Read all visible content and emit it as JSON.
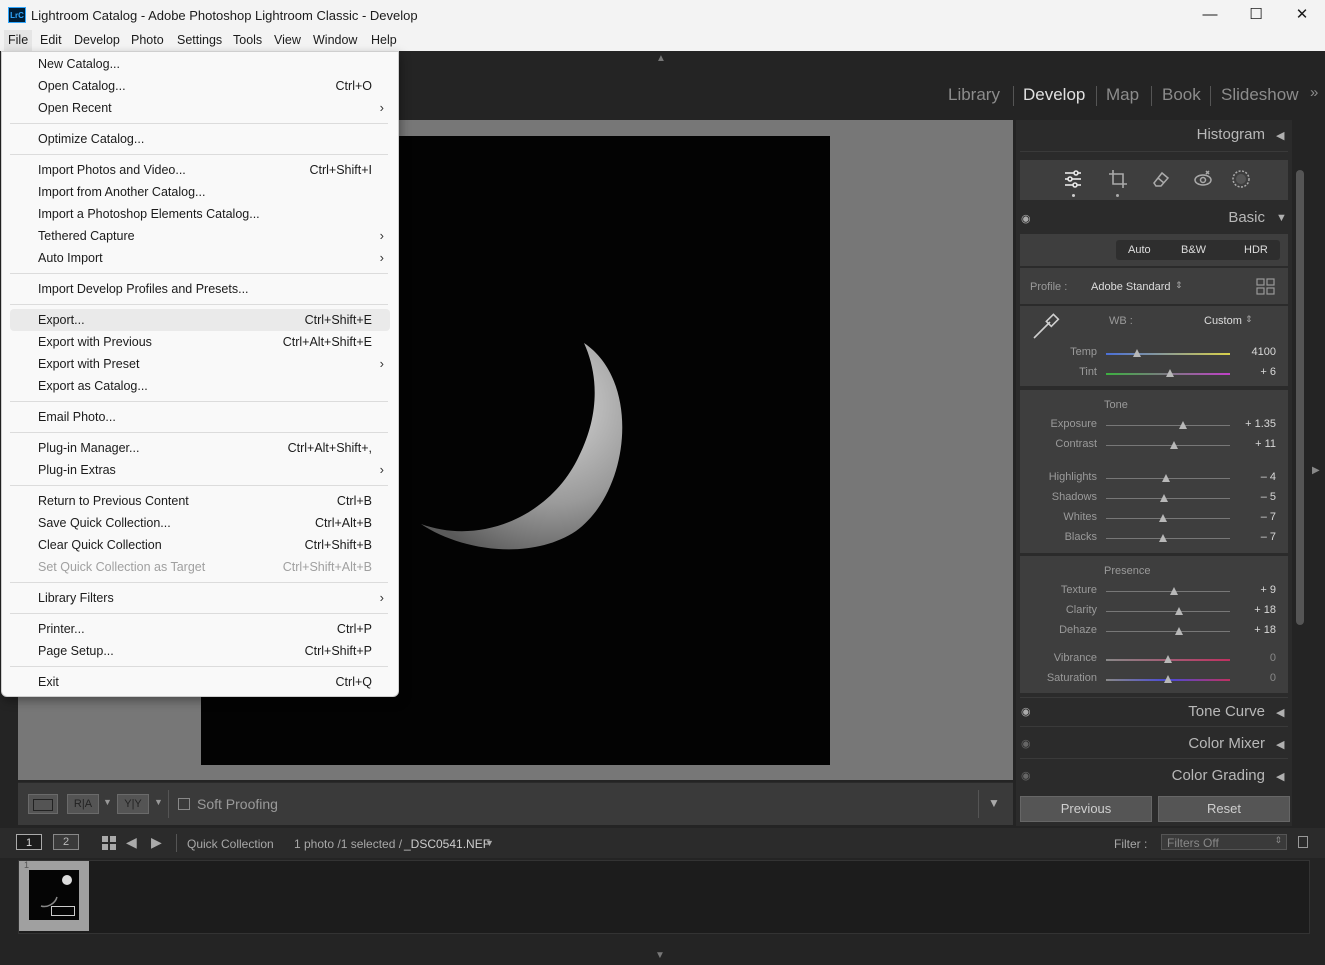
{
  "window": {
    "title": "Lightroom Catalog - Adobe Photoshop Lightroom Classic - Develop",
    "app_icon": "LrC",
    "controls": {
      "minimize": "—",
      "maximize": "☐",
      "close": "✕"
    }
  },
  "menubar": [
    "File",
    "Edit",
    "Develop",
    "Photo",
    "Settings",
    "Tools",
    "View",
    "Window",
    "Help"
  ],
  "modules": [
    "Library",
    "Develop",
    "Map",
    "Book",
    "Slideshow"
  ],
  "active_module": "Develop",
  "file_menu": {
    "items": [
      {
        "label": "New Catalog...",
        "shortcut": ""
      },
      {
        "label": "Open Catalog...",
        "shortcut": "Ctrl+O"
      },
      {
        "label": "Open Recent",
        "shortcut": "",
        "submenu": true
      },
      {
        "sep": true
      },
      {
        "label": "Optimize Catalog...",
        "shortcut": ""
      },
      {
        "sep": true
      },
      {
        "label": "Import Photos and Video...",
        "shortcut": "Ctrl+Shift+I"
      },
      {
        "label": "Import from Another Catalog...",
        "shortcut": ""
      },
      {
        "label": "Import a Photoshop Elements Catalog...",
        "shortcut": ""
      },
      {
        "label": "Tethered Capture",
        "shortcut": "",
        "submenu": true
      },
      {
        "label": "Auto Import",
        "shortcut": "",
        "submenu": true
      },
      {
        "sep": true
      },
      {
        "label": "Import Develop Profiles and Presets...",
        "shortcut": ""
      },
      {
        "sep": true
      },
      {
        "label": "Export...",
        "shortcut": "Ctrl+Shift+E",
        "highlighted": true
      },
      {
        "label": "Export with Previous",
        "shortcut": "Ctrl+Alt+Shift+E"
      },
      {
        "label": "Export with Preset",
        "shortcut": "",
        "submenu": true
      },
      {
        "label": "Export as Catalog...",
        "shortcut": ""
      },
      {
        "sep": true
      },
      {
        "label": "Email Photo...",
        "shortcut": ""
      },
      {
        "sep": true
      },
      {
        "label": "Plug-in Manager...",
        "shortcut": "Ctrl+Alt+Shift+,"
      },
      {
        "label": "Plug-in Extras",
        "shortcut": "",
        "submenu": true
      },
      {
        "sep": true
      },
      {
        "label": "Return to Previous Content",
        "shortcut": "Ctrl+B"
      },
      {
        "label": "Save Quick Collection...",
        "shortcut": "Ctrl+Alt+B"
      },
      {
        "label": "Clear Quick Collection",
        "shortcut": "Ctrl+Shift+B"
      },
      {
        "label": "Set Quick Collection as Target",
        "shortcut": "Ctrl+Shift+Alt+B",
        "disabled": true
      },
      {
        "sep": true
      },
      {
        "label": "Library Filters",
        "shortcut": "",
        "submenu": true
      },
      {
        "sep": true
      },
      {
        "label": "Printer...",
        "shortcut": "Ctrl+P"
      },
      {
        "label": "Page Setup...",
        "shortcut": "Ctrl+Shift+P"
      },
      {
        "sep": true
      },
      {
        "label": "Exit",
        "shortcut": "Ctrl+Q"
      }
    ]
  },
  "right_panel": {
    "histogram": "Histogram",
    "basic": "Basic",
    "treatment": [
      "Auto",
      "B&W",
      "HDR"
    ],
    "profile_label": "Profile :",
    "profile_value": "Adobe Standard",
    "wb_label": "WB :",
    "wb_value": "Custom",
    "tone_heading": "Tone",
    "presence_heading": "Presence",
    "sliders": [
      {
        "label": "Temp",
        "value": "4100",
        "pos": 0.25
      },
      {
        "label": "Tint",
        "value": "+ 6",
        "pos": 0.52
      },
      {
        "label": "Exposure",
        "value": "+ 1.35",
        "pos": 0.62
      },
      {
        "label": "Contrast",
        "value": "+ 11",
        "pos": 0.55
      },
      {
        "label": "Highlights",
        "value": "– 4",
        "pos": 0.48
      },
      {
        "label": "Shadows",
        "value": "– 5",
        "pos": 0.47
      },
      {
        "label": "Whites",
        "value": "– 7",
        "pos": 0.46
      },
      {
        "label": "Blacks",
        "value": "– 7",
        "pos": 0.46
      },
      {
        "label": "Texture",
        "value": "+ 9",
        "pos": 0.55
      },
      {
        "label": "Clarity",
        "value": "+ 18",
        "pos": 0.59
      },
      {
        "label": "Dehaze",
        "value": "+ 18",
        "pos": 0.59
      },
      {
        "label": "Vibrance",
        "value": "0",
        "pos": 0.5
      },
      {
        "label": "Saturation",
        "value": "0",
        "pos": 0.5
      }
    ],
    "tone_curve": "Tone Curve",
    "color_mixer": "Color Mixer",
    "color_grading": "Color Grading",
    "previous_button": "Previous",
    "reset_button": "Reset"
  },
  "toolbar": {
    "soft_proofing": "Soft Proofing",
    "before_after_ra": "R|A",
    "before_after_yy": "Y|Y"
  },
  "filmstrip": {
    "screen1": "1",
    "screen2": "2",
    "source": "Quick Collection",
    "info": "1 photo /1 selected /",
    "filename": "_DSC0541.NEF",
    "filter_label": "Filter :",
    "filter_value": "Filters Off",
    "thumb_index": "1"
  }
}
